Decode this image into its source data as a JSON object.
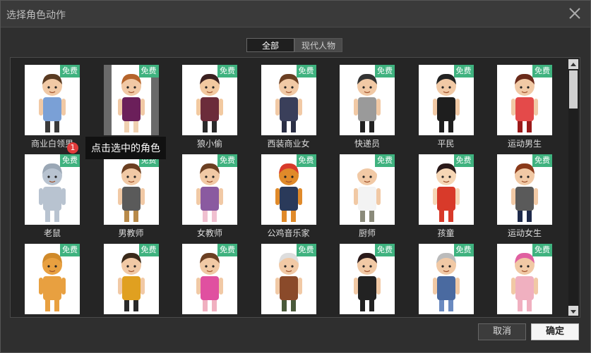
{
  "dialog": {
    "title": "选择角色动作",
    "close_icon": "close-icon"
  },
  "tabs": [
    {
      "label": "全部",
      "active": true
    },
    {
      "label": "现代人物",
      "active": false
    }
  ],
  "badge_label": "免费",
  "characters": [
    {
      "name": "商业白领男",
      "skin": "#f1c9a5",
      "hair": "#5a3b22",
      "top": "#7aa0d6",
      "bottom": "#3a3a3a"
    },
    {
      "name": "",
      "skin": "#f1c9a5",
      "hair": "#b5642b",
      "top": "#6b1f5a",
      "bottom": "#f0d0b0",
      "selected": true
    },
    {
      "name": "狼小偷",
      "skin": "#f2c9a0",
      "hair": "#3a2020",
      "top": "#6b2c3a",
      "bottom": "#2a2a2a"
    },
    {
      "name": "西装商业女",
      "skin": "#f1c9a5",
      "hair": "#6b3f22",
      "top": "#3a3f5a",
      "bottom": "#2b2f45"
    },
    {
      "name": "快递员",
      "skin": "#f1c9a5",
      "hair": "#333",
      "top": "#9a9a9a",
      "bottom": "#222"
    },
    {
      "name": "平民",
      "skin": "#f1c9a5",
      "hair": "#222",
      "top": "#1e1e1e",
      "bottom": "#1e1e1e"
    },
    {
      "name": "运动男生",
      "skin": "#f1c9a5",
      "hair": "#6a2a1a",
      "top": "#e44a4a",
      "bottom": "#9a1a1a"
    },
    {
      "name": "老鼠",
      "skin": "#b8c3d0",
      "hair": "#9aa7b5",
      "top": "#b8c3d0",
      "bottom": "#b8c3d0"
    },
    {
      "name": "男教师",
      "skin": "#f1c9a5",
      "hair": "#6b3f22",
      "top": "#5a5a5a",
      "bottom": "#b88a4a"
    },
    {
      "name": "女教师",
      "skin": "#f1c9a5",
      "hair": "#6b3f22",
      "top": "#8a5aa0",
      "bottom": "#f0c0d0"
    },
    {
      "name": "公鸡音乐家",
      "skin": "#e08a2a",
      "hair": "#d83a2a",
      "top": "#2a3a5a",
      "bottom": "#e08a2a"
    },
    {
      "name": "厨师",
      "skin": "#f1c9a5",
      "hair": "#ffffff",
      "top": "#f3f3f3",
      "bottom": "#8a8a7a"
    },
    {
      "name": "孩童",
      "skin": "#f6d6b5",
      "hair": "#2a1a1a",
      "top": "#d83a2a",
      "bottom": "#d83a2a"
    },
    {
      "name": "运动女生",
      "skin": "#f1c9a5",
      "hair": "#8a3a1a",
      "top": "#5a5a5a",
      "bottom": "#1e2a4a"
    },
    {
      "name": "",
      "skin": "#e8a040",
      "hair": "#d08a2a",
      "top": "#e8a040",
      "bottom": "#e8a040"
    },
    {
      "name": "",
      "skin": "#f1c9a5",
      "hair": "#3a2a1a",
      "top": "#e0a020",
      "bottom": "#2a2a2a"
    },
    {
      "name": "",
      "skin": "#f1c9a5",
      "hair": "#6b3f22",
      "top": "#e050a0",
      "bottom": "#f0b0c0"
    },
    {
      "name": "",
      "skin": "#f1c9a5",
      "hair": "#dddddd",
      "top": "#8a4a2a",
      "bottom": "#4a5a3a"
    },
    {
      "name": "",
      "skin": "#f1c9a5",
      "hair": "#2a1a1a",
      "top": "#222",
      "bottom": "#222"
    },
    {
      "name": "",
      "skin": "#f1c9a5",
      "hair": "#bbbbbb",
      "top": "#4a6aa0",
      "bottom": "#6a8ac0"
    },
    {
      "name": "",
      "skin": "#f1c9a5",
      "hair": "#e060a0",
      "top": "#f0b0c0",
      "bottom": "#f0b0c0"
    }
  ],
  "tooltip": {
    "step": "1",
    "text": "点击选中的角色"
  },
  "buttons": {
    "cancel": "取消",
    "ok": "确定"
  }
}
